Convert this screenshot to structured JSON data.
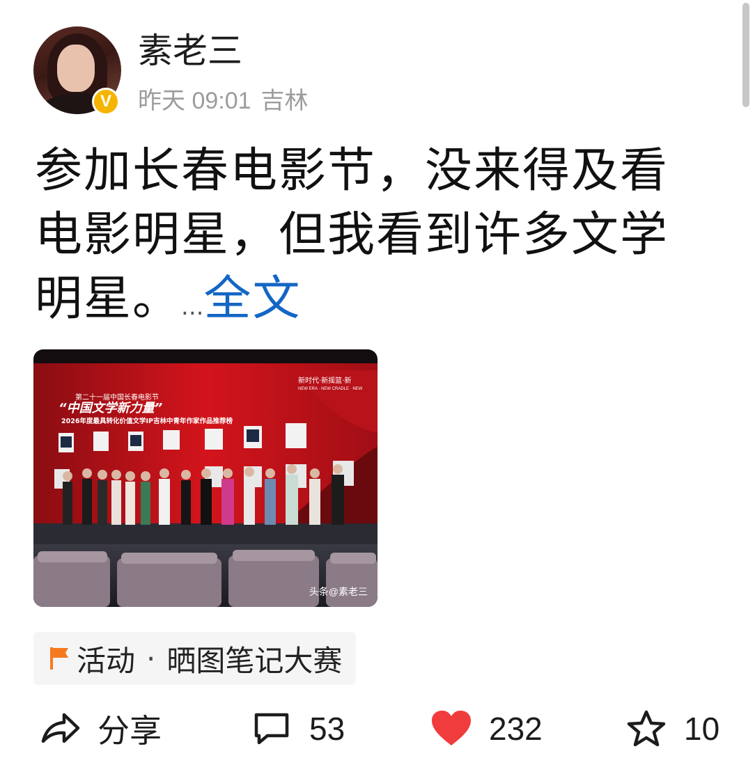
{
  "author": {
    "name": "素老三",
    "verified_badge": "V",
    "time": "昨天 09:01",
    "location": "吉林"
  },
  "post": {
    "text": "参加长春电影节，没来得及看电影明星，但我看到许多文学明星。",
    "ellipsis": "...",
    "more_link": "全文"
  },
  "photo": {
    "banner_small": "第二十一届中国长春电影节",
    "banner_title": "“中国文学新力量”",
    "banner_subtitle": "2026年度最具转化价值文学IP吉林中青年作家作品推荐榜",
    "banner_right": "新时代·新摇篮·新",
    "banner_right_en": "NEW ERA · NEW CRADLE · NEW",
    "watermark": "头条@素老三"
  },
  "activity": {
    "icon": "flag-icon",
    "prefix": "活动",
    "separator": "·",
    "name": "晒图笔记大赛"
  },
  "actions": {
    "share_label": "分享",
    "comments": "53",
    "likes": "232",
    "favorites": "10"
  },
  "colors": {
    "link": "#1366c4",
    "like": "#f03c3c",
    "badge": "#f5b400",
    "flag": "#f57a1f"
  }
}
